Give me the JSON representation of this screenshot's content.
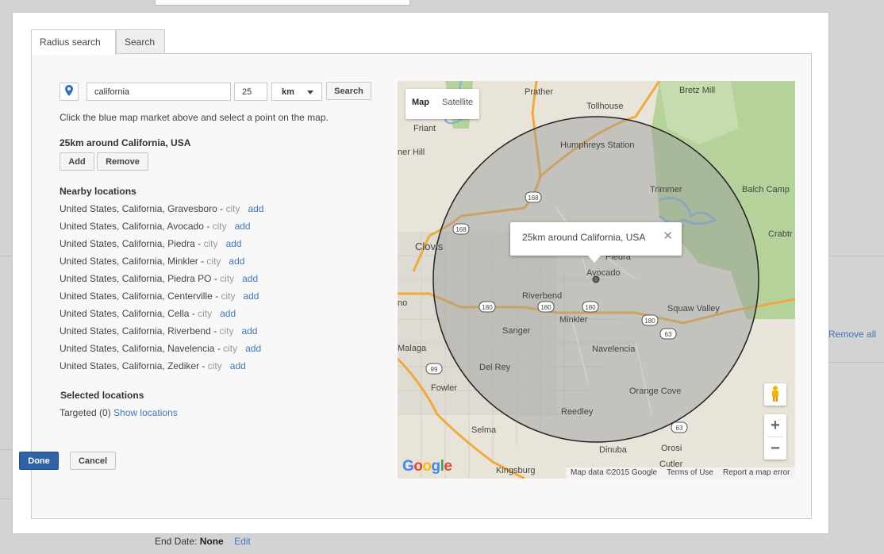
{
  "background": {
    "remove_all": "Remove all",
    "end_date_label": "End Date:",
    "end_date_value": "None",
    "edit_link": "Edit"
  },
  "tabs": [
    {
      "label": "Radius search",
      "active": true
    },
    {
      "label": "Search",
      "active": false
    }
  ],
  "search": {
    "query": "california",
    "radius": "25",
    "unit": "km",
    "button": "Search",
    "pin_icon": "map-pin-icon"
  },
  "hint": "Click the blue map market above and select a point on the map.",
  "selection_title": "25km around California, USA",
  "add_button": "Add",
  "remove_button": "Remove",
  "nearby": {
    "title": "Nearby locations",
    "kind_suffix": "city",
    "add_label": "add",
    "items": [
      {
        "name": "United States, California, Gravesboro"
      },
      {
        "name": "United States, California, Avocado"
      },
      {
        "name": "United States, California, Piedra"
      },
      {
        "name": "United States, California, Minkler"
      },
      {
        "name": "United States, California, Piedra PO"
      },
      {
        "name": "United States, California, Centerville"
      },
      {
        "name": "United States, California, Cella"
      },
      {
        "name": "United States, California, Riverbend"
      },
      {
        "name": "United States, California, Navelencia"
      },
      {
        "name": "United States, California, Zediker"
      }
    ]
  },
  "selected": {
    "title": "Selected locations",
    "targeted": "Targeted (0)",
    "show_link": "Show locations"
  },
  "done_button": "Done",
  "cancel_button": "Cancel",
  "map": {
    "toggle_map": "Map",
    "toggle_satellite": "Satellite",
    "infowindow": "25km around California, USA",
    "footer": [
      "Map data ©2015 Google",
      "Terms of Use",
      "Report a map error"
    ],
    "logo": [
      "G",
      "o",
      "o",
      "g",
      "l",
      "e"
    ],
    "places": [
      "Prather",
      "Bretz Mill",
      "Tollhouse",
      "Friant",
      "Humphreys Station",
      "Trimmer",
      "Balch Camp",
      "Clovis",
      "Piedra",
      "Avocado",
      "Riverbend",
      "Squaw Valley",
      "Crabtr",
      "Sanger",
      "Minkler",
      "Navelencia",
      "Malaga",
      "Del Rey",
      "Fowler",
      "Orange Cove",
      "Reedley",
      "Selma",
      "Dinuba",
      "Orosi",
      "Cutler",
      "Kingsburg",
      "ner Hill",
      "no"
    ],
    "highways": [
      "168",
      "168",
      "180",
      "180",
      "180",
      "180",
      "63",
      "63",
      "99"
    ],
    "colors": {
      "circle_fill": "#9a9a9a",
      "road": "#f2a93b",
      "forest": "#b5d29b",
      "water": "#7fb2dc"
    }
  }
}
